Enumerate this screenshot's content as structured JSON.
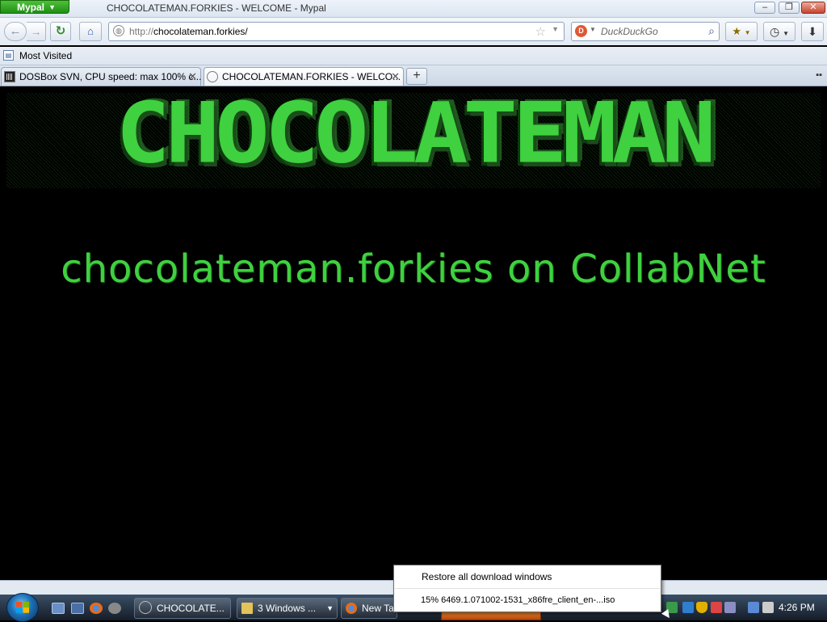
{
  "window": {
    "app_button": "Mypal",
    "title": "CHOCOLATEMAN.FORKIES - WELCOME - Mypal",
    "minimize": "–",
    "maximize": "❐",
    "close": "✕"
  },
  "toolbar": {
    "back": "←",
    "forward": "→",
    "reload": "↻",
    "home": "⌂",
    "url_protocol": "http://",
    "url_host": "chocolateman.forkies/",
    "search_engine_icon": "duckduckgo-icon",
    "search_placeholder": "DuckDuckGo"
  },
  "bookmarks_bar": {
    "most_visited": "Most Visited"
  },
  "tabs": [
    {
      "label": "DOSBox SVN, CPU speed: max 100% c...",
      "active": false
    },
    {
      "label": "CHOCOLATEMAN.FORKIES - WELCO...",
      "active": true
    }
  ],
  "page": {
    "banner": "CHOCOLATEMAN",
    "subtitle": "chocolateman.forkies on CollabNet",
    "text_color": "#3fd13f",
    "background": "#000000"
  },
  "taskbar": {
    "tasks": [
      {
        "label": "CHOCOLATE..."
      },
      {
        "label": "3 Windows ..."
      },
      {
        "label": "New Ta"
      }
    ],
    "clock": "4:26 PM"
  },
  "download_popup": {
    "restore": "Restore all download windows",
    "item": "15% 6469.1.071002-1531_x86fre_client_en-...iso"
  }
}
